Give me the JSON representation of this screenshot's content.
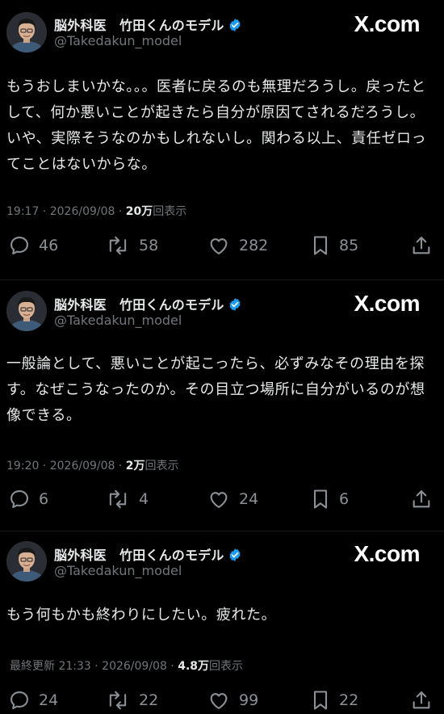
{
  "brand": {
    "logo_text": "X.com"
  },
  "posts": [
    {
      "author": {
        "display_name": "脳外科医　竹田くんのモデル",
        "handle": "@Takedakun_model",
        "verified": true
      },
      "text": "もうおしまいかな。。。医者に戻るのも無理だろうし。戻ったとして、何か悪いことが起きたら自分が原因てされるだろうし。いや、実際そうなのかもしれないし。関わる以上、責任ゼロってことはないからな。",
      "meta": {
        "time": "19:17",
        "date": "2026/09/08",
        "views_count": "20万",
        "views_label": "回表示"
      },
      "stats": {
        "replies": "46",
        "reposts": "58",
        "likes": "282",
        "bookmarks": "85"
      }
    },
    {
      "author": {
        "display_name": "脳外科医　竹田くんのモデル",
        "handle": "@Takedakun_model",
        "verified": true
      },
      "text": "一般論として、悪いことが起こったら、必ずみなその理由を探す。なぜこうなったのか。その目立つ場所に自分がいるのが想像できる。",
      "meta": {
        "time": "19:20",
        "date": "2026/09/08",
        "views_count": "2万",
        "views_label": "回表示"
      },
      "stats": {
        "replies": "6",
        "reposts": "4",
        "likes": "24",
        "bookmarks": "6"
      }
    },
    {
      "author": {
        "display_name": "脳外科医　竹田くんのモデル",
        "handle": "@Takedakun_model",
        "verified": true
      },
      "text": "もう何もかも終わりにしたい。疲れた。",
      "meta": {
        "time": "最終更新 21:33",
        "date": "2026/09/08",
        "views_count": "4.8万",
        "views_label": "回表示"
      },
      "stats": {
        "replies": "24",
        "reposts": "22",
        "likes": "99",
        "bookmarks": "22"
      }
    }
  ],
  "colors": {
    "background": "#000000",
    "text_primary": "#e7e9ea",
    "text_secondary": "#71767b",
    "verified_badge": "#1d9bf0",
    "icon_gray": "#8b9096"
  },
  "icons": [
    "verified-badge-icon",
    "reply-icon",
    "repost-icon",
    "like-icon",
    "bookmark-icon",
    "share-icon"
  ]
}
